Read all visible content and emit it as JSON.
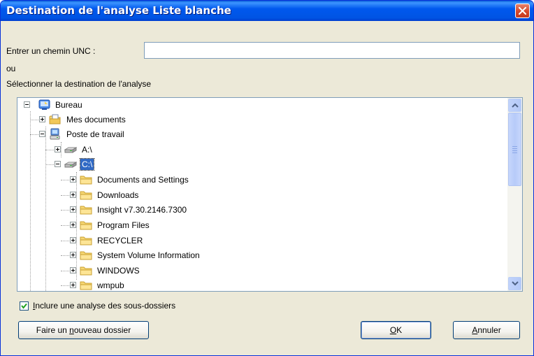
{
  "window": {
    "title": "Destination de l'analyse Liste blanche"
  },
  "unc": {
    "label": "Entrer un chemin UNC :",
    "value": ""
  },
  "or_label": "ou",
  "select_label": "Sélectionner la destination de l'analyse",
  "tree": {
    "bureau": "Bureau",
    "mes_documents": "Mes documents",
    "poste_de_travail": "Poste de travail",
    "drive_a": "A:\\",
    "drive_c": "C:\\",
    "folders": [
      "Documents and Settings",
      "Downloads",
      "Insight v7.30.2146.7300",
      "Program Files",
      "RECYCLER",
      "System Volume Information",
      "WINDOWS",
      "wmpub"
    ],
    "selected": "C:\\"
  },
  "subfolders": {
    "label_prefix": "I",
    "label_rest": "nclure une analyse des sous-dossiers",
    "checked": true
  },
  "buttons": {
    "new_folder_pre": "Faire un ",
    "new_folder_u": "n",
    "new_folder_post": "ouveau dossier",
    "ok_u": "O",
    "ok_post": "K",
    "cancel_u": "A",
    "cancel_post": "nnuler"
  },
  "icons": {
    "bureau": "desktop-icon",
    "mes_documents": "my-documents-icon",
    "poste_de_travail": "my-computer-icon",
    "drive": "drive-icon",
    "folder": "folder-icon",
    "close": "close-icon"
  },
  "colors": {
    "titlebar": "#0054e3",
    "selection": "#316ac5",
    "dialog_bg": "#ece9d8",
    "close": "#d6482a"
  }
}
